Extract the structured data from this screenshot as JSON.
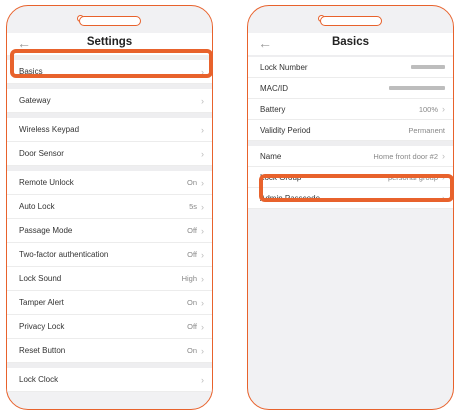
{
  "left_screen": {
    "title": "Settings",
    "back_icon": "arrow-left-icon",
    "items": [
      {
        "label": "Basics",
        "value": ""
      },
      {
        "label": "Gateway",
        "value": ""
      },
      {
        "label": "Wireless Keypad",
        "value": ""
      },
      {
        "label": "Door Sensor",
        "value": ""
      },
      {
        "label": "Remote Unlock",
        "value": "On"
      },
      {
        "label": "Auto Lock",
        "value": "5s"
      },
      {
        "label": "Passage Mode",
        "value": "Off"
      },
      {
        "label": "Two-factor authentication",
        "value": "Off"
      },
      {
        "label": "Lock Sound",
        "value": "High"
      },
      {
        "label": "Tamper Alert",
        "value": "On"
      },
      {
        "label": "Privacy Lock",
        "value": "Off"
      },
      {
        "label": "Reset Button",
        "value": "On"
      },
      {
        "label": "Lock Clock",
        "value": ""
      }
    ]
  },
  "right_screen": {
    "title": "Basics",
    "back_icon": "arrow-left-icon",
    "items": [
      {
        "label": "Lock Number",
        "value": ""
      },
      {
        "label": "MAC/ID",
        "value": ""
      },
      {
        "label": "Battery",
        "value": "100%"
      },
      {
        "label": "Validity Period",
        "value": "Permanent"
      },
      {
        "label": "Name",
        "value": "Home front door #2"
      },
      {
        "label": "Lock Group",
        "value": "personal group"
      },
      {
        "label": "Admin Passcode",
        "value": ""
      }
    ]
  },
  "colors": {
    "accent": "#e8622c",
    "background": "#f1f1f3"
  }
}
